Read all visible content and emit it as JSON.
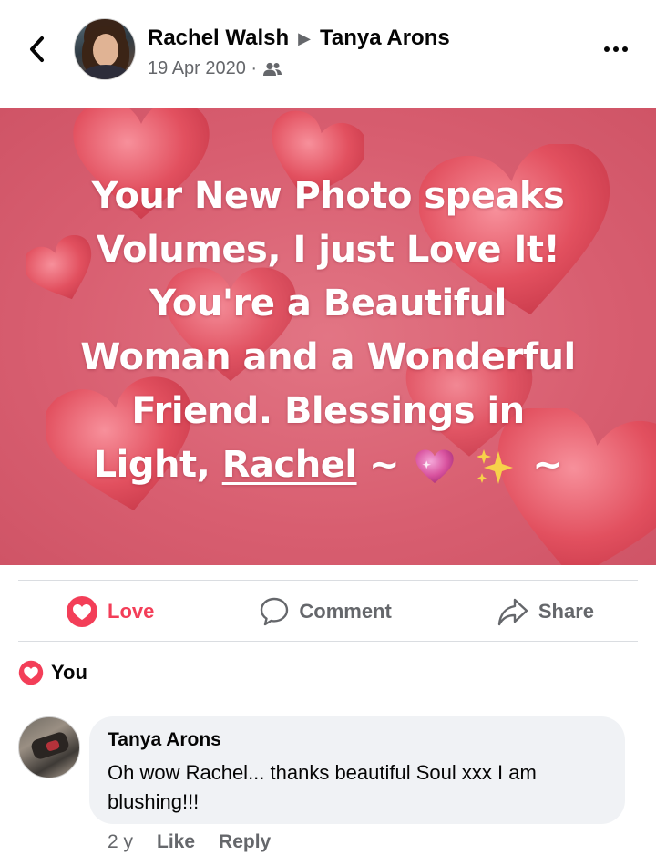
{
  "header": {
    "author": "Rachel Walsh",
    "target": "Tanya Arons",
    "date": "19 Apr 2020 ·",
    "audience_icon": "friends-icon"
  },
  "post": {
    "line1": "Your New Photo speaks",
    "line2": "Volumes, I just Love It!",
    "line3": "You're a Beautiful",
    "line4": "Woman and a Wonderful",
    "line5": "Friend. Blessings in",
    "line6_prefix": "Light, ",
    "line6_name": "Rachel",
    "line6_tilde1": "~",
    "line6_tilde2": "~",
    "background_color": "#d85e70"
  },
  "actions": {
    "love_label": "Love",
    "comment_label": "Comment",
    "share_label": "Share",
    "love_color": "#f33e58"
  },
  "reactions": {
    "label": "You"
  },
  "comment": {
    "author": "Tanya Arons",
    "text": "Oh wow Rachel... thanks beautiful Soul xxx I am blushing!!!",
    "time": "2 y",
    "like_label": "Like",
    "reply_label": "Reply"
  }
}
